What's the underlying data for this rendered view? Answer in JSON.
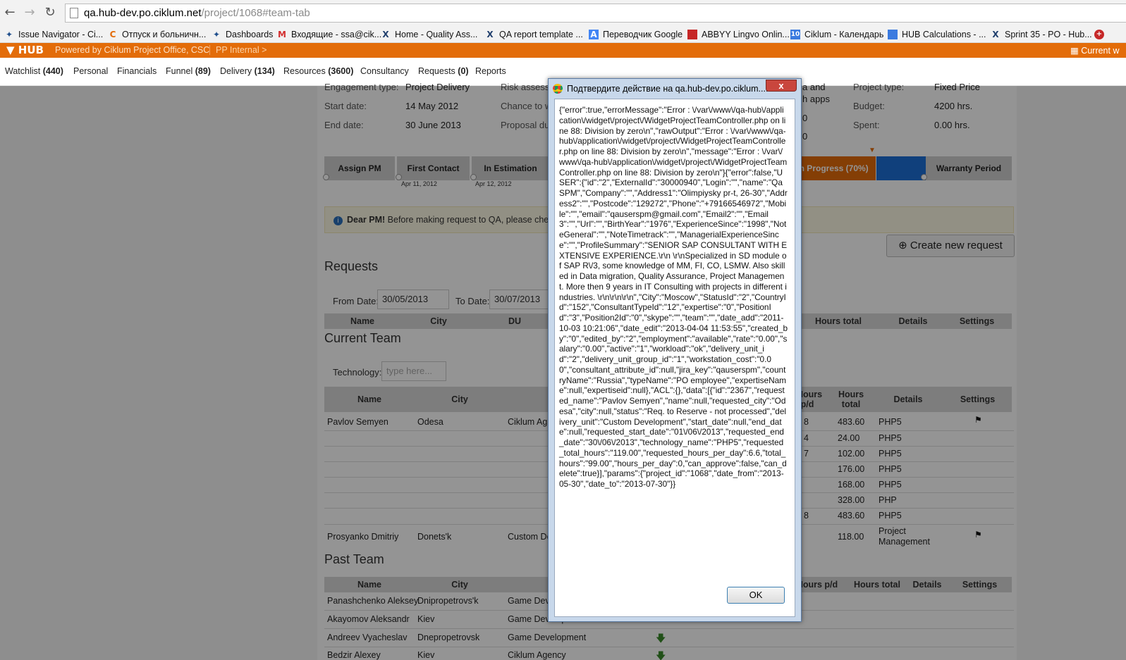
{
  "browser": {
    "url_host": "qa.hub-dev.po.ciklum.net",
    "url_path": "/project/1068#team-tab",
    "bookmarks": [
      {
        "label": "Issue Navigator - Ci...",
        "icon": "jira-icon"
      },
      {
        "label": "Отпуск и больничн...",
        "icon": "c-logo-icon"
      },
      {
        "label": "Dashboards",
        "icon": "jira-icon"
      },
      {
        "label": "Входящие - ssa@cik...",
        "icon": "gmail-icon"
      },
      {
        "label": "Home - Quality Ass...",
        "icon": "x-logo-icon"
      },
      {
        "label": "QA report template ...",
        "icon": "x-logo-icon"
      },
      {
        "label": "Переводчик Google",
        "icon": "translate-icon"
      },
      {
        "label": "ABBYY Lingvo Onlin...",
        "icon": "book-icon"
      },
      {
        "label": "Ciklum - Календарь",
        "icon": "calendar-icon"
      },
      {
        "label": "HUB Calculations - ...",
        "icon": "doc-icon"
      },
      {
        "label": "Sprint 35 - PO - Hub...",
        "icon": "x-logo-icon"
      }
    ]
  },
  "hub": {
    "logo": "HUB",
    "powered": "Powered by Ciklum Project Office, CSC",
    "pp": "PP Internal >",
    "current": "Current w"
  },
  "menu": [
    {
      "label": "Watchlist",
      "count": "(440)"
    },
    {
      "label": "Personal",
      "count": ""
    },
    {
      "label": "Financials",
      "count": ""
    },
    {
      "label": "Funnel",
      "count": "(89)"
    },
    {
      "label": "Delivery",
      "count": "(134)"
    },
    {
      "label": "Resources",
      "count": "(3600)"
    },
    {
      "label": "Consultancy",
      "count": ""
    },
    {
      "label": "Requests",
      "count": "(0)"
    },
    {
      "label": "Reports",
      "count": ""
    }
  ],
  "project": {
    "engagement_label": "Engagement type:",
    "engagement_value": "Project Delivery",
    "start_label": "Start date:",
    "start_value": "14 May 2012",
    "end_label": "End date:",
    "end_value": "30 June 2013",
    "risk_label": "Risk assess",
    "chance_label": "Chance to w",
    "proposal_label": "Proposal du",
    "partial1": "a and",
    "partial2": "h apps",
    "partial3": "0",
    "partial4": "0",
    "type_label": "Project type:",
    "type_value": "Fixed Price",
    "budget_label": "Budget:",
    "budget_value": "4200 hrs.",
    "spent_label": "Spent:",
    "spent_value": "0.00 hrs."
  },
  "stages": [
    {
      "label": "Assign PM",
      "date": ""
    },
    {
      "label": "First Contact",
      "date": "Apr 11, 2012"
    },
    {
      "label": "In Estimation",
      "date": "Apr 12, 2012"
    },
    {
      "label": "in Progress (70%)",
      "date": "12"
    },
    {
      "label": "Warranty Period",
      "date": ""
    }
  ],
  "notice": {
    "bold": "Dear PM!",
    "text": " Before making request to QA, please check "
  },
  "create_button": "Create new request",
  "requests": {
    "title": "Requests",
    "from_label": "From Date:",
    "from_value": "30/05/2013",
    "to_label": "To Date:",
    "to_value": "30/07/2013",
    "headers": [
      "Name",
      "City",
      "DU",
      "Hours total",
      "Details",
      "Settings"
    ]
  },
  "current_team": {
    "title": "Current Team",
    "tech_label": "Technology:",
    "tech_placeholder": "type here...",
    "headers": [
      "Name",
      "City",
      "Hours p/d",
      "Hours total",
      "Details",
      "Settings"
    ],
    "rows": [
      {
        "name": "Pavlov Semyen",
        "city": "Odesa",
        "du": "Ciklum Ag",
        "hpd": "8",
        "total": "483.60",
        "details": "PHP5"
      },
      {
        "name": "",
        "city": "",
        "du": "",
        "hpd": "4",
        "total": "24.00",
        "details": "PHP5"
      },
      {
        "name": "",
        "city": "",
        "du": "",
        "hpd": "7",
        "total": "102.00",
        "details": "PHP5"
      },
      {
        "name": "",
        "city": "",
        "du": "",
        "hpd": "",
        "total": "176.00",
        "details": "PHP5"
      },
      {
        "name": "",
        "city": "",
        "du": "",
        "hpd": "",
        "total": "168.00",
        "details": "PHP5"
      },
      {
        "name": "",
        "city": "",
        "du": "",
        "hpd": "",
        "total": "328.00",
        "details": "PHP"
      },
      {
        "name": "",
        "city": "",
        "du": "",
        "hpd": "8",
        "total": "483.60",
        "details": "PHP5"
      },
      {
        "name": "Prosyanko Dmitriy",
        "city": "Donets'k",
        "du": "Custom De",
        "hpd": "",
        "total": "118.00",
        "details": "Project Management"
      }
    ]
  },
  "past_team": {
    "title": "Past Team",
    "headers": [
      "Name",
      "City",
      "Hours p/d",
      "Hours total",
      "Details",
      "Settings"
    ],
    "rows": [
      {
        "name": "Panashchenko Aleksey",
        "city": "Dnipropetrovs'k",
        "du": "Game Devel"
      },
      {
        "name": "Akayomov Aleksandr",
        "city": "Kiev",
        "du": "Game Development"
      },
      {
        "name": "Andreev Vyacheslav",
        "city": "Dnepropetrovsk",
        "du": "Game Development"
      },
      {
        "name": "Bedzir Alexey",
        "city": "Kiev",
        "du": "Ciklum Agency"
      }
    ]
  },
  "dialog": {
    "title": "Подтвердите действие на qa.hub-dev.po.ciklum....",
    "close": "x",
    "ok": "OK",
    "message": "{\"error\":true,\"errorMessage\":\"Error : \\/var\\/www\\/qa-hub\\/application\\/widget\\/project\\/WidgetProjectTeamController.php on line 88: Division by zero\\n\",\"rawOutput\":\"Error : \\/var\\/www\\/qa-hub\\/application\\/widget\\/project\\/WidgetProjectTeamController.php on line 88: Division by zero\\n\",\"message\":\"Error : \\/var\\/www\\/qa-hub\\/application\\/widget\\/project\\/WidgetProjectTeamController.php on line 88: Division by zero\\n\"}{\"error\":false,\"USER\":{\"id\":\"2\",\"ExternalId\":\"30000940\",\"Login\":\"\",\"name\":\"Qa SPM\",\"Company\":\"\",\"Address1\":\"Olimpiysky pr-t, 26-30\",\"Address2\":\"\",\"Postcode\":\"129272\",\"Phone\":\"+79166546972\",\"Mobile\":\"\",\"email\":\"qauserspm@gmail.com\",\"Email2\":\"\",\"Email3\":\"\",\"Url\":\"\",\"BirthYear\":\"1976\",\"ExperienceSince\":\"1998\",\"NoteGeneral\":\"\",\"NoteTimetrack\":\"\",\"ManagerialExperienceSince\":\"\",\"ProfileSummary\":\"SENIOR SAP CONSULTANT WITH EXTENSIVE EXPERIENCE.\\r\\n \\r\\nSpecialized in SD module of SAP R\\/3, some knowledge of MM, FI, CO, LSMW. Also skilled in Data migration, Quality Assurance, Project Management. More then 9 years in IT Consulting with projects in different industries. \\r\\n\\r\\n\\r\\n\",\"City\":\"Moscow\",\"StatusId\":\"2\",\"CountryId\":\"152\",\"ConsultantTypeId\":\"12\",\"expertise\":\"0\",\"PositionId\":\"3\",\"Position2Id\":\"0\",\"skype\":\"\",\"team\":\"\",\"date_add\":\"2011-10-03 10:21:06\",\"date_edit\":\"2013-04-04 11:53:55\",\"created_by\":\"0\",\"edited_by\":\"2\",\"employment\":\"available\",\"rate\":\"0.00\",\"salary\":\"0.00\",\"active\":\"1\",\"workload\":\"ok\",\"delivery_unit_id\":\"2\",\"delivery_unit_group_id\":\"1\",\"workstation_cost\":\"0.00\",\"consultant_attribute_id\":null,\"jira_key\":\"qauserspm\",\"countryName\":\"Russia\",\"typeName\":\"PO employee\",\"expertiseName\":null,\"expertiseid\":null},\"ACL\":{},\"data\":[{\"id\":\"2367\",\"requested_name\":\"Pavlov Semyen\",\"name\":null,\"requested_city\":\"Odesa\",\"city\":null,\"status\":\"Req. to Reserve - not processed\",\"delivery_unit\":\"Custom Development\",\"start_date\":null,\"end_date\":null,\"requested_start_date\":\"01\\/06\\/2013\",\"requested_end_date\":\"30\\/06\\/2013\",\"technology_name\":\"PHP5\",\"requested_total_hours\":\"119.00\",\"requested_hours_per_day\":6.6,\"total_hours\":\"99.00\",\"hours_per_day\":0,\"can_approve\":false,\"can_delete\":true}],\"params\":{\"project_id\":\"1068\",\"date_from\":\"2013-05-30\",\"date_to\":\"2013-07-30\"}}"
  }
}
